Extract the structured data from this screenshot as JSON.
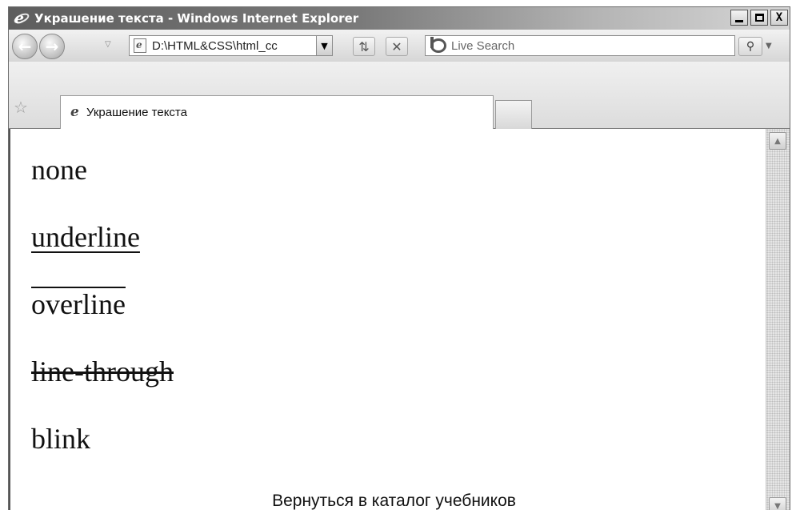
{
  "window": {
    "title": "Украшение текста - Windows Internet Explorer",
    "controls": {
      "minimize": "_",
      "maximize": "□",
      "close": "X"
    }
  },
  "toolbar": {
    "address": "D:\\HTML&CSS\\html_cc",
    "search_placeholder": "Live Search",
    "icons": {
      "back": "back-arrow-icon",
      "forward": "forward-arrow-icon",
      "refresh": "refresh-icon",
      "stop": "stop-icon",
      "search": "search-magnifier-icon",
      "live": "live-search-icon"
    }
  },
  "tabs": [
    {
      "label": "Украшение текста",
      "active": true
    }
  ],
  "content": {
    "lines": [
      {
        "text": "none",
        "decoration": "none"
      },
      {
        "text": "underline",
        "decoration": "underline"
      },
      {
        "text": "overline",
        "decoration": "overline"
      },
      {
        "text": "line-through",
        "decoration": "line-through"
      },
      {
        "text": "blink",
        "decoration": "blink"
      }
    ]
  },
  "caption": "Вернуться в каталог учебников"
}
